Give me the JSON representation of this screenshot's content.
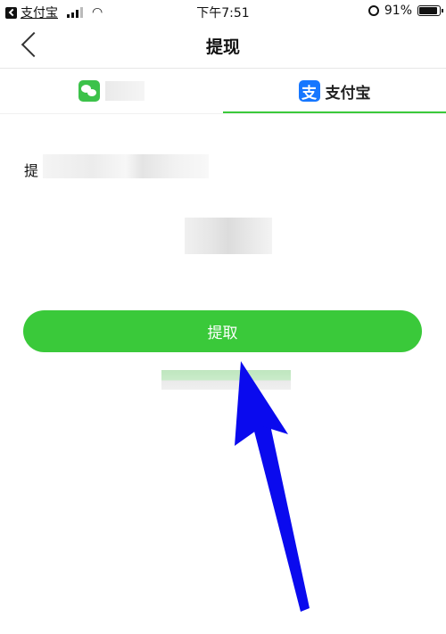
{
  "status_bar": {
    "back_app": "支付宝",
    "time": "下午7:51",
    "battery": "91%",
    "battery_level": 0.91
  },
  "nav": {
    "title": "提现"
  },
  "tabs": [
    {
      "label": "",
      "icon": "wechat-icon",
      "selected": false
    },
    {
      "label": "支付宝",
      "icon": "alipay-icon",
      "icon_glyph": "支",
      "selected": true
    }
  ],
  "form": {
    "row_label": "提"
  },
  "actions": {
    "withdraw_label": "提取"
  },
  "colors": {
    "accent": "#3ac93a",
    "alipay": "#1677ff",
    "wechat": "#3cc24a",
    "annotation_arrow": "#0a0aee"
  }
}
